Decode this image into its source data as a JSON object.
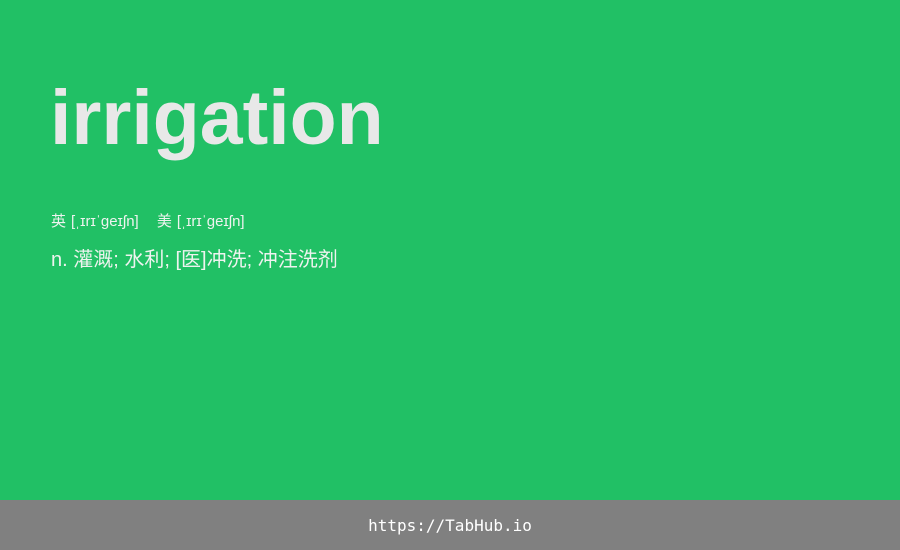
{
  "card": {
    "word": "irrigation",
    "phonetics": {
      "uk_label": "英",
      "uk_ipa": "[ˌɪrɪˈgeɪʃn]",
      "us_label": "美",
      "us_ipa": "[ˌɪrɪˈgeɪʃn]"
    },
    "definition": "n. 灌溉; 水利; [医]冲洗; 冲注洗剂"
  },
  "footer": {
    "link_text": "https://TabHub.io"
  },
  "colors": {
    "card_background": "#21c065",
    "footer_background": "#808080",
    "word_text": "#e8e8e8"
  }
}
